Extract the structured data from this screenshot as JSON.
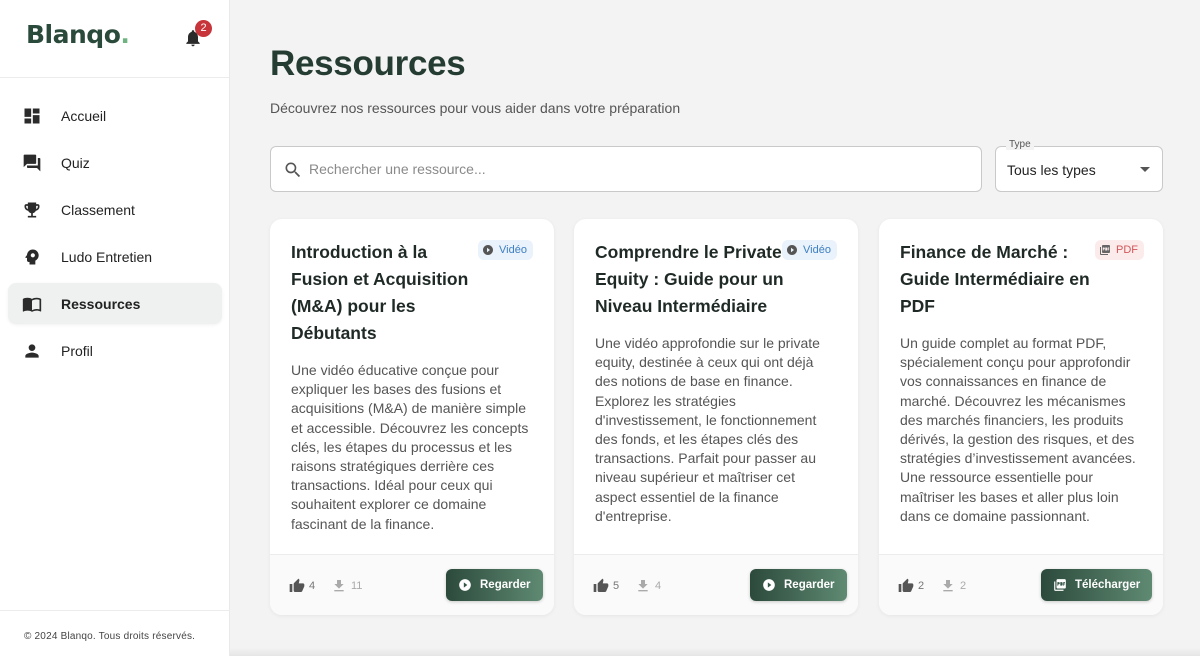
{
  "brand": {
    "name": "Blanqo",
    "dot": ".",
    "notifications": "2"
  },
  "sidebar": {
    "items": [
      {
        "label": "Accueil",
        "icon": "dashboard-icon"
      },
      {
        "label": "Quiz",
        "icon": "forum-icon"
      },
      {
        "label": "Classement",
        "icon": "trophy-icon"
      },
      {
        "label": "Ludo Entretien",
        "icon": "psychology-icon"
      },
      {
        "label": "Ressources",
        "icon": "book-icon",
        "active": true
      },
      {
        "label": "Profil",
        "icon": "person-icon"
      }
    ],
    "copyright": "© 2024 Blanqo. Tous droits réservés."
  },
  "main": {
    "title": "Ressources",
    "subtitle": "Découvrez nos ressources pour vous aider dans votre préparation",
    "search": {
      "placeholder": "Rechercher une ressource...",
      "value": ""
    },
    "type_filter": {
      "legend": "Type",
      "value": "Tous les types"
    }
  },
  "cards": [
    {
      "title": "Introduction à la Fusion et Acquisition (M&A) pour les Débutants",
      "badge": "Vidéo",
      "badge_type": "video",
      "description": "Une vidéo éducative conçue pour expliquer les bases des fusions et acquisitions (M&A) de manière simple et accessible. Découvrez les concepts clés, les étapes du processus et les raisons stratégiques derrière ces transactions. Idéal pour ceux qui souhaitent explorer ce domaine fascinant de la finance.",
      "likes": "4",
      "downloads": "11",
      "action": "Regarder"
    },
    {
      "title": "Comprendre le Private Equity : Guide pour un Niveau Intermédiaire",
      "badge": "Vidéo",
      "badge_type": "video",
      "description": "Une vidéo approfondie sur le private equity, destinée à ceux qui ont déjà des notions de base en finance. Explorez les stratégies d'investissement, le fonctionnement des fonds, et les étapes clés des transactions. Parfait pour passer au niveau supérieur et maîtriser cet aspect essentiel de la finance d'entreprise.",
      "likes": "5",
      "downloads": "4",
      "action": "Regarder"
    },
    {
      "title": "Finance de Marché : Guide Intermédiaire en PDF",
      "badge": "PDF",
      "badge_type": "pdf",
      "description": "Un guide complet au format PDF, spécialement conçu pour approfondir vos connaissances en finance de marché. Découvrez les mécanismes des marchés financiers, les produits dérivés, la gestion des risques, et des stratégies d’investissement avancées. Une ressource essentielle pour maîtriser les bases et aller plus loin dans ce domaine passionnant.",
      "likes": "2",
      "downloads": "2",
      "action": "Télécharger"
    }
  ],
  "colors": {
    "brand_dark": "#2a4a3b",
    "brand_accent": "#6fb382",
    "button_gradient_start": "#2c4a3c",
    "button_gradient_end": "#5f8a72",
    "video_badge": "#3d7fc4",
    "pdf_badge": "#d2575a",
    "notification": "#c7353a"
  }
}
